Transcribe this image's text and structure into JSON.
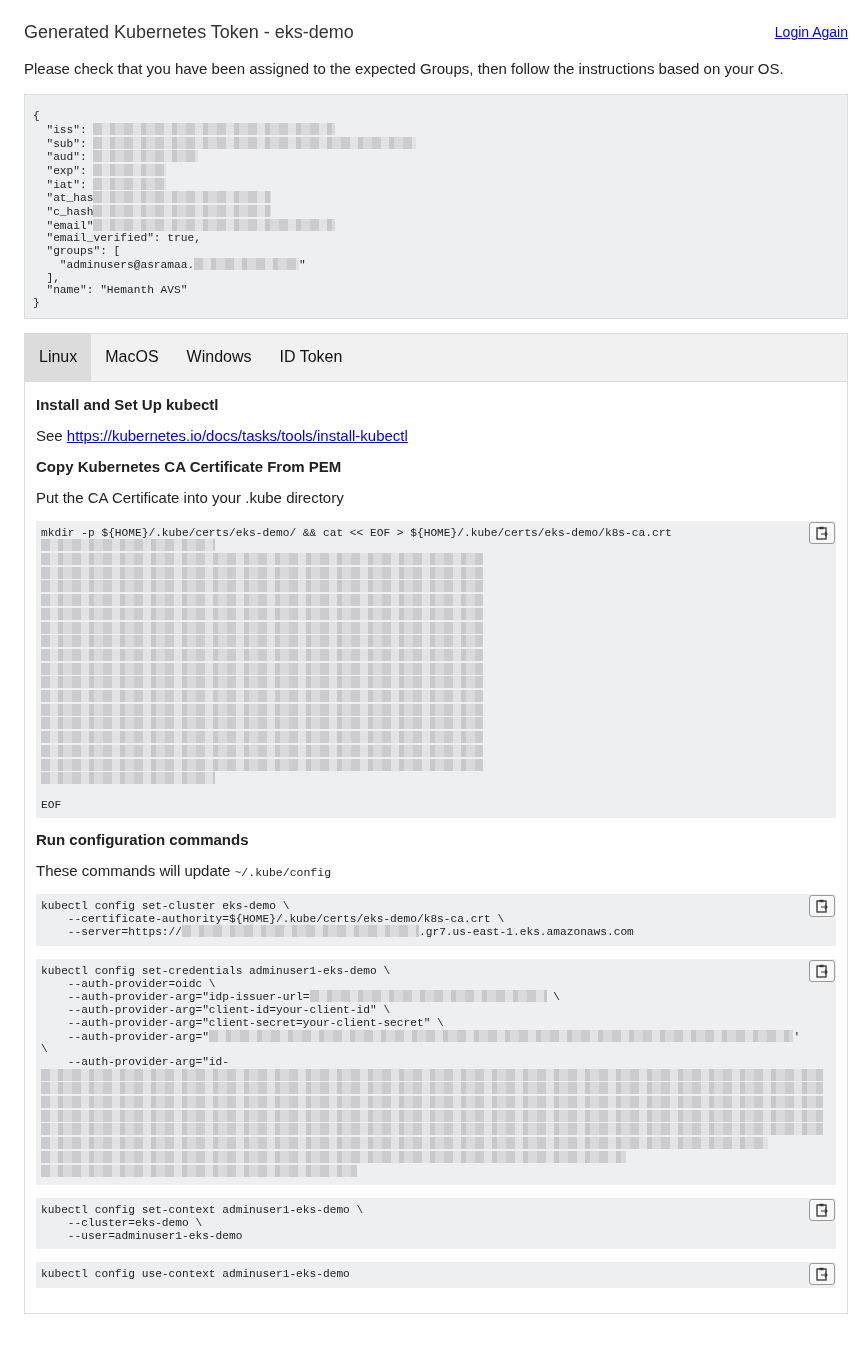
{
  "header": {
    "title": "Generated Kubernetes Token - eks-demo",
    "login_link": "Login Again",
    "intro": "Please check that you have been assigned to the expected Groups, then follow the instructions based on your OS."
  },
  "token_claims": {
    "lines": [
      [
        {
          "kind": "text",
          "text": "{"
        }
      ],
      [
        {
          "kind": "text",
          "text": "  \"iss\": "
        },
        {
          "kind": "redacted_medium"
        }
      ],
      [
        {
          "kind": "text",
          "text": "  \"sub\": "
        },
        {
          "kind": "redacted_half"
        }
      ],
      [
        {
          "kind": "text",
          "text": "  \"aud\": "
        },
        {
          "kind": "redacted_short"
        }
      ],
      [
        {
          "kind": "text",
          "text": "  \"exp\": "
        },
        {
          "kind": "redacted_tiny"
        }
      ],
      [
        {
          "kind": "text",
          "text": "  \"iat\": "
        },
        {
          "kind": "redacted_tiny"
        }
      ],
      [
        {
          "kind": "text",
          "text": "  \"at_has"
        },
        {
          "kind": "redacted_small"
        }
      ],
      [
        {
          "kind": "text",
          "text": "  \"c_hash"
        },
        {
          "kind": "redacted_small"
        }
      ],
      [
        {
          "kind": "text",
          "text": "  \"email\""
        },
        {
          "kind": "redacted_medium"
        }
      ],
      [
        {
          "kind": "text",
          "text": "  \"email_verified\": true,"
        }
      ],
      [
        {
          "kind": "text",
          "text": "  \"groups\": ["
        }
      ],
      [
        {
          "kind": "text",
          "text": "    \"adminusers@asramaa."
        },
        {
          "kind": "redacted_short"
        },
        {
          "kind": "text",
          "text": "\""
        }
      ],
      [
        {
          "kind": "text",
          "text": "  ],"
        }
      ],
      [
        {
          "kind": "text",
          "text": "  \"name\": \"Hemanth AVS\""
        }
      ],
      [
        {
          "kind": "text",
          "text": "}"
        }
      ]
    ]
  },
  "tabs": [
    {
      "label": "Linux",
      "selected": true
    },
    {
      "label": "MacOS",
      "selected": false
    },
    {
      "label": "Windows",
      "selected": false
    },
    {
      "label": "ID Token",
      "selected": false
    }
  ],
  "content": [
    {
      "kind": "heading",
      "parts": [
        {
          "kind": "text",
          "text": "Install and Set Up kubectl"
        }
      ]
    },
    {
      "kind": "paragraph",
      "parts": [
        {
          "kind": "text",
          "text": "See "
        },
        {
          "kind": "link",
          "text": "https://kubernetes.io/docs/tasks/tools/install-kubectl"
        }
      ]
    },
    {
      "kind": "heading",
      "parts": [
        {
          "kind": "text",
          "text": "Copy Kubernetes CA Certificate From PEM"
        }
      ]
    },
    {
      "kind": "paragraph",
      "parts": [
        {
          "kind": "text",
          "text": "Put the CA Certificate into your .kube directory"
        }
      ]
    },
    {
      "kind": "code",
      "copy_button": true,
      "lines": [
        [
          {
            "kind": "text",
            "text": "mkdir -p ${HOME}/.kube/certs/eks-demo/ && cat << EOF > ${HOME}/.kube/certs/eks-demo/k8s-ca.crt"
          }
        ],
        [
          {
            "kind": "redacted_small"
          }
        ],
        [
          {
            "kind": "redacted_cert"
          }
        ],
        [
          {
            "kind": "redacted_cert"
          }
        ],
        [
          {
            "kind": "redacted_cert"
          }
        ],
        [
          {
            "kind": "redacted_cert"
          }
        ],
        [
          {
            "kind": "redacted_cert"
          }
        ],
        [
          {
            "kind": "redacted_cert"
          }
        ],
        [
          {
            "kind": "redacted_cert"
          }
        ],
        [
          {
            "kind": "redacted_cert"
          }
        ],
        [
          {
            "kind": "redacted_cert"
          }
        ],
        [
          {
            "kind": "redacted_cert"
          }
        ],
        [
          {
            "kind": "redacted_cert"
          }
        ],
        [
          {
            "kind": "redacted_cert"
          }
        ],
        [
          {
            "kind": "redacted_cert"
          }
        ],
        [
          {
            "kind": "redacted_cert"
          }
        ],
        [
          {
            "kind": "redacted_cert"
          }
        ],
        [
          {
            "kind": "redacted_cert"
          }
        ],
        [
          {
            "kind": "redacted_small"
          }
        ],
        [
          {
            "kind": "blank"
          }
        ],
        [
          {
            "kind": "text",
            "text": "EOF"
          }
        ]
      ]
    },
    {
      "kind": "heading",
      "parts": [
        {
          "kind": "text",
          "text": "Run configuration commands"
        }
      ]
    },
    {
      "kind": "paragraph",
      "parts": [
        {
          "kind": "text",
          "text": "These commands will update "
        },
        {
          "kind": "code",
          "text": "~/.kube/config"
        }
      ]
    },
    {
      "kind": "code",
      "copy_button": true,
      "lines": [
        [
          {
            "kind": "text",
            "text": "kubectl config set-cluster eks-demo \\"
          }
        ],
        [
          {
            "kind": "text",
            "text": "    --certificate-authority=${HOME}/.kube/certs/eks-demo/k8s-ca.crt \\"
          }
        ],
        [
          {
            "kind": "text",
            "text": "    --server=https://"
          },
          {
            "kind": "redacted_medium"
          },
          {
            "kind": "text",
            "text": ".gr7.us-east-1.eks.amazonaws.com"
          }
        ]
      ]
    },
    {
      "kind": "code",
      "copy_button": true,
      "lines": [
        [
          {
            "kind": "text",
            "text": "kubectl config set-credentials adminuser1-eks-demo \\"
          }
        ],
        [
          {
            "kind": "text",
            "text": "    --auth-provider=oidc \\"
          }
        ],
        [
          {
            "kind": "text",
            "text": "    --auth-provider-arg=\"idp-issuer-url="
          },
          {
            "kind": "redacted_medium"
          },
          {
            "kind": "text",
            "text": " \\"
          }
        ],
        [
          {
            "kind": "text",
            "text": "    --auth-provider-arg=\"client-id=your-client-id\" \\"
          }
        ],
        [
          {
            "kind": "text",
            "text": "    --auth-provider-arg=\"client-secret=your-client-secret\" \\"
          }
        ],
        [
          {
            "kind": "text",
            "text": "    --auth-provider-arg=\""
          },
          {
            "kind": "redacted_long"
          },
          {
            "kind": "text",
            "text": "'"
          }
        ],
        [
          {
            "kind": "text",
            "text": "\\"
          }
        ],
        [
          {
            "kind": "text",
            "text": "    --auth-provider-arg=\"id-"
          }
        ],
        [
          {
            "kind": "redacted_full"
          }
        ],
        [
          {
            "kind": "redacted_full"
          }
        ],
        [
          {
            "kind": "redacted_full"
          }
        ],
        [
          {
            "kind": "redacted_full"
          }
        ],
        [
          {
            "kind": "redacted_full"
          }
        ],
        [
          {
            "kind": "redacted_most"
          }
        ],
        [
          {
            "kind": "redacted_long"
          }
        ],
        [
          {
            "kind": "redacted_half"
          }
        ]
      ]
    },
    {
      "kind": "code",
      "copy_button": true,
      "lines": [
        [
          {
            "kind": "text",
            "text": "kubectl config set-context adminuser1-eks-demo \\"
          }
        ],
        [
          {
            "kind": "text",
            "text": "    --cluster=eks-demo \\"
          }
        ],
        [
          {
            "kind": "text",
            "text": "    --user=adminuser1-eks-demo"
          }
        ]
      ]
    },
    {
      "kind": "code",
      "copy_button": true,
      "lines": [
        [
          {
            "kind": "text",
            "text": "kubectl config use-context adminuser1-eks-demo"
          }
        ]
      ]
    }
  ]
}
